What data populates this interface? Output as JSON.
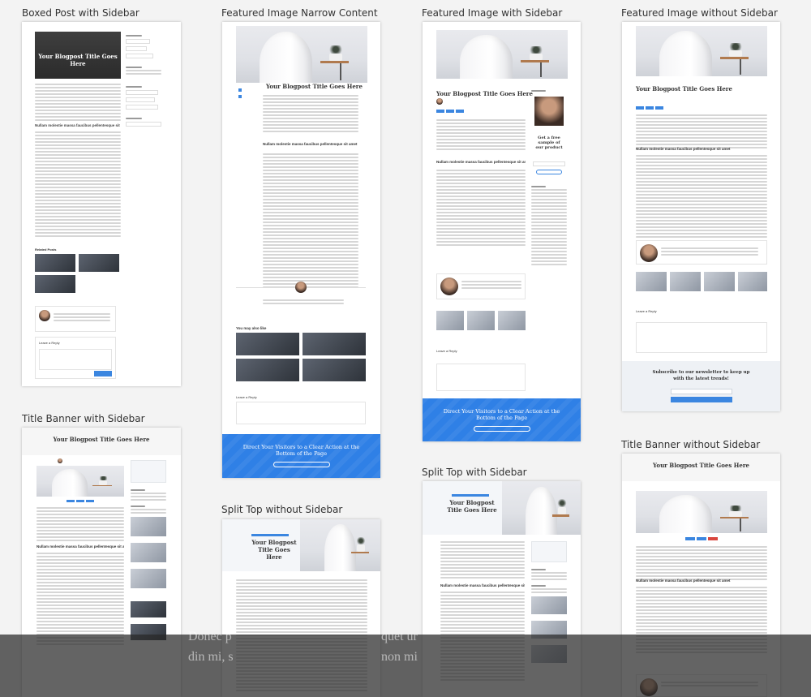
{
  "captions": {
    "boxed": "Boxed Post with Sidebar",
    "narrow": "Featured Image Narrow Content",
    "with_sidebar": "Featured Image with Sidebar",
    "without_sidebar": "Featured Image without Sidebar",
    "title_banner_sidebar": "Title Banner with Sidebar",
    "split_top_no_sidebar": "Split Top without Sidebar",
    "split_top_sidebar": "Split Top with Sidebar",
    "title_banner_no_sidebar": "Title Banner without Sidebar"
  },
  "post": {
    "title": "Your Blogpost Title Goes Here",
    "title_line1": "Your Blogpost",
    "title_line2": "Title Goes Here",
    "subheading": "Nullam molestie massa faucibus pellentesque sit amet",
    "related": "Related Posts",
    "you_may_also_like": "You may also like",
    "leave_reply": "Leave a Reply"
  },
  "cta": {
    "line1": "Direct Your Visitors to a Clear Action at the",
    "line2": "Bottom of the Page"
  },
  "newsletter": {
    "line1": "Subscribe to our newsletter to keep up",
    "line2": "with the latest trends!"
  },
  "sidebar": {
    "promo_line1": "Get a free",
    "promo_line2": "sample of",
    "promo_line3": "our product"
  },
  "overlay": {
    "left": "Donec p",
    "mid": "din mi, s",
    "right_top": "quet ur",
    "right_bottom": "non mi"
  },
  "colors": {
    "accent": "#3b86e0",
    "promo_accent": "#f0a030"
  }
}
